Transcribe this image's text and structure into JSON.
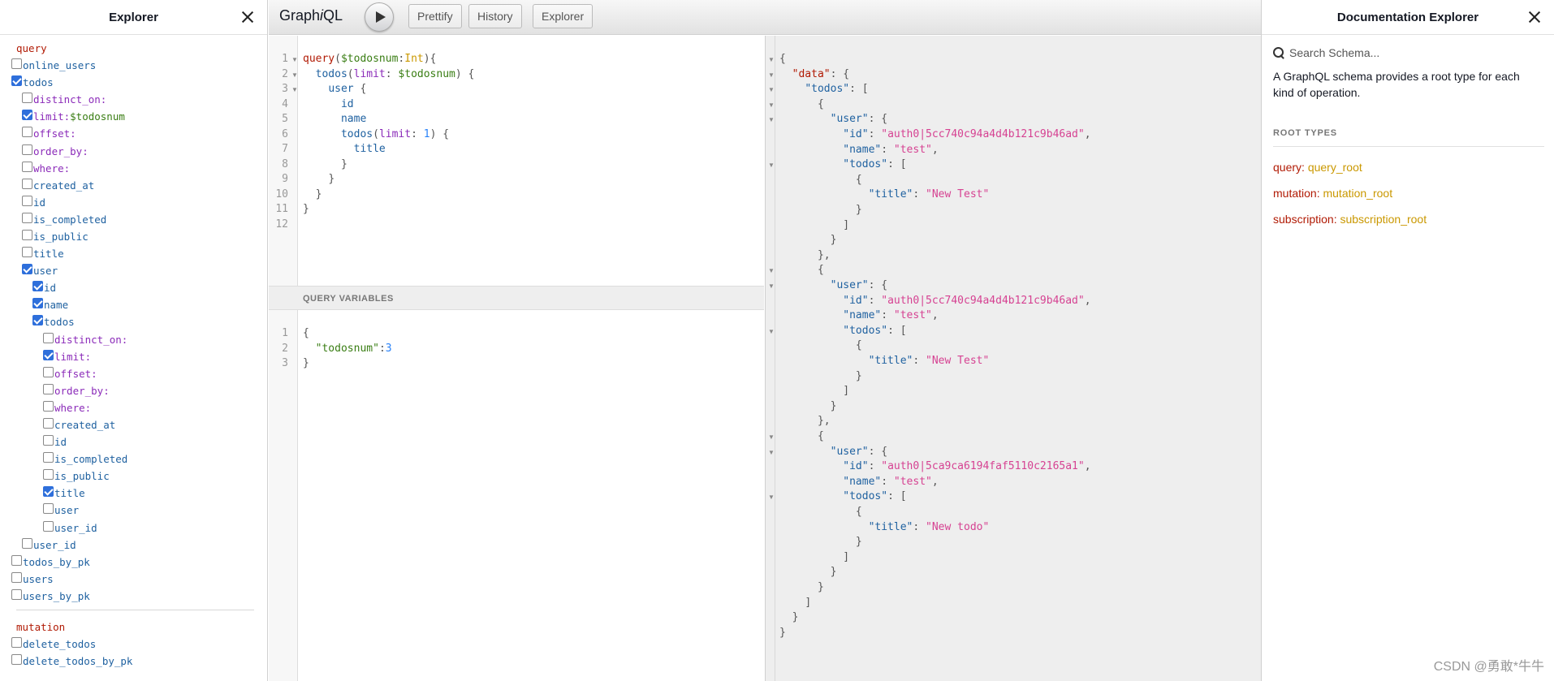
{
  "explorer": {
    "title": "Explorer",
    "query_label": "query",
    "mutation_label": "mutation",
    "rows": [
      {
        "indent": 0,
        "checked": false,
        "label": "online_users",
        "kind": "fld"
      },
      {
        "indent": 0,
        "checked": true,
        "label": "todos",
        "kind": "fld"
      },
      {
        "indent": 1,
        "checked": false,
        "label": "distinct_on:",
        "kind": "arg"
      },
      {
        "indent": 1,
        "checked": true,
        "label": "limit:",
        "kind": "arg",
        "value": "$todosnum"
      },
      {
        "indent": 1,
        "checked": false,
        "label": "offset:",
        "kind": "arg"
      },
      {
        "indent": 1,
        "checked": false,
        "label": "order_by:",
        "kind": "arg"
      },
      {
        "indent": 1,
        "checked": false,
        "label": "where:",
        "kind": "arg"
      },
      {
        "indent": 1,
        "checked": false,
        "label": "created_at",
        "kind": "fld"
      },
      {
        "indent": 1,
        "checked": false,
        "label": "id",
        "kind": "fld"
      },
      {
        "indent": 1,
        "checked": false,
        "label": "is_completed",
        "kind": "fld"
      },
      {
        "indent": 1,
        "checked": false,
        "label": "is_public",
        "kind": "fld"
      },
      {
        "indent": 1,
        "checked": false,
        "label": "title",
        "kind": "fld"
      },
      {
        "indent": 1,
        "checked": true,
        "label": "user",
        "kind": "fld"
      },
      {
        "indent": 2,
        "checked": true,
        "label": "id",
        "kind": "fld"
      },
      {
        "indent": 2,
        "checked": true,
        "label": "name",
        "kind": "fld"
      },
      {
        "indent": 2,
        "checked": true,
        "label": "todos",
        "kind": "fld"
      },
      {
        "indent": 3,
        "checked": false,
        "label": "distinct_on:",
        "kind": "arg"
      },
      {
        "indent": 3,
        "checked": true,
        "label": "limit:",
        "kind": "arg",
        "value": ""
      },
      {
        "indent": 3,
        "checked": false,
        "label": "offset:",
        "kind": "arg"
      },
      {
        "indent": 3,
        "checked": false,
        "label": "order_by:",
        "kind": "arg"
      },
      {
        "indent": 3,
        "checked": false,
        "label": "where:",
        "kind": "arg"
      },
      {
        "indent": 3,
        "checked": false,
        "label": "created_at",
        "kind": "fld"
      },
      {
        "indent": 3,
        "checked": false,
        "label": "id",
        "kind": "fld"
      },
      {
        "indent": 3,
        "checked": false,
        "label": "is_completed",
        "kind": "fld"
      },
      {
        "indent": 3,
        "checked": false,
        "label": "is_public",
        "kind": "fld"
      },
      {
        "indent": 3,
        "checked": true,
        "label": "title",
        "kind": "fld"
      },
      {
        "indent": 3,
        "checked": false,
        "label": "user",
        "kind": "fld"
      },
      {
        "indent": 3,
        "checked": false,
        "label": "user_id",
        "kind": "fld"
      },
      {
        "indent": 1,
        "checked": false,
        "label": "user_id",
        "kind": "fld"
      },
      {
        "indent": 0,
        "checked": false,
        "label": "todos_by_pk",
        "kind": "fld"
      },
      {
        "indent": 0,
        "checked": false,
        "label": "users",
        "kind": "fld"
      },
      {
        "indent": 0,
        "checked": false,
        "label": "users_by_pk",
        "kind": "fld"
      }
    ],
    "mutation_rows": [
      {
        "indent": 0,
        "checked": false,
        "label": "delete_todos",
        "kind": "fld"
      },
      {
        "indent": 0,
        "checked": false,
        "label": "delete_todos_by_pk",
        "kind": "fld"
      }
    ]
  },
  "toolbar": {
    "logo_prefix": "Graph",
    "logo_italic": "i",
    "logo_suffix": "QL",
    "prettify": "Prettify",
    "history": "History",
    "explorer": "Explorer"
  },
  "query_editor": {
    "line_numbers": [
      "1",
      "2",
      "3",
      "4",
      "5",
      "6",
      "7",
      "8",
      "9",
      "10",
      "11",
      "12"
    ],
    "fold_lines": [
      1,
      2,
      3
    ],
    "lines": [
      [
        {
          "t": "query",
          "c": "kw"
        },
        {
          "t": "(",
          "c": "punc"
        },
        {
          "t": "$todosnum",
          "c": "var"
        },
        {
          "t": ":",
          "c": "punc"
        },
        {
          "t": "Int",
          "c": "typ"
        },
        {
          "t": "){",
          "c": "punc"
        }
      ],
      [
        {
          "t": "  "
        },
        {
          "t": "todos",
          "c": "prop"
        },
        {
          "t": "(",
          "c": "punc"
        },
        {
          "t": "limit",
          "c": "arg"
        },
        {
          "t": ": ",
          "c": "punc"
        },
        {
          "t": "$todosnum",
          "c": "var"
        },
        {
          "t": ") {",
          "c": "punc"
        }
      ],
      [
        {
          "t": "    "
        },
        {
          "t": "user",
          "c": "prop"
        },
        {
          "t": " {",
          "c": "punc"
        }
      ],
      [
        {
          "t": "      "
        },
        {
          "t": "id",
          "c": "prop"
        }
      ],
      [
        {
          "t": "      "
        },
        {
          "t": "name",
          "c": "prop"
        }
      ],
      [
        {
          "t": "      "
        },
        {
          "t": "todos",
          "c": "prop"
        },
        {
          "t": "(",
          "c": "punc"
        },
        {
          "t": "limit",
          "c": "arg"
        },
        {
          "t": ": ",
          "c": "punc"
        },
        {
          "t": "1",
          "c": "num"
        },
        {
          "t": ") {",
          "c": "punc"
        }
      ],
      [
        {
          "t": "        "
        },
        {
          "t": "title",
          "c": "prop"
        }
      ],
      [
        {
          "t": "      "
        },
        {
          "t": "}",
          "c": "punc"
        }
      ],
      [
        {
          "t": "    "
        },
        {
          "t": "}",
          "c": "punc"
        }
      ],
      [
        {
          "t": "  "
        },
        {
          "t": "}",
          "c": "punc"
        }
      ],
      [
        {
          "t": "}",
          "c": "punc"
        }
      ],
      []
    ]
  },
  "vars": {
    "header": "QUERY VARIABLES",
    "line_numbers": [
      "1",
      "2",
      "3"
    ],
    "lines": [
      [
        {
          "t": "{",
          "c": "punc"
        }
      ],
      [
        {
          "t": "  "
        },
        {
          "t": "\"todosnum\"",
          "c": "var"
        },
        {
          "t": ":",
          "c": "punc"
        },
        {
          "t": "3",
          "c": "num"
        }
      ],
      [
        {
          "t": "}",
          "c": "punc"
        }
      ]
    ]
  },
  "result": {
    "fold_lines": [
      1,
      2,
      3,
      4,
      5,
      8,
      15,
      16,
      19,
      26,
      27,
      30
    ],
    "lines": [
      [
        {
          "t": "{",
          "c": "punc"
        }
      ],
      [
        {
          "t": "  "
        },
        {
          "t": "\"data\"",
          "c": "kw"
        },
        {
          "t": ": {",
          "c": "punc"
        }
      ],
      [
        {
          "t": "    "
        },
        {
          "t": "\"todos\"",
          "c": "jkey"
        },
        {
          "t": ": [",
          "c": "punc"
        }
      ],
      [
        {
          "t": "      "
        },
        {
          "t": "{",
          "c": "punc"
        }
      ],
      [
        {
          "t": "        "
        },
        {
          "t": "\"user\"",
          "c": "jkey"
        },
        {
          "t": ": {",
          "c": "punc"
        }
      ],
      [
        {
          "t": "          "
        },
        {
          "t": "\"id\"",
          "c": "jkey"
        },
        {
          "t": ": ",
          "c": "punc"
        },
        {
          "t": "\"auth0|5cc740c94a4d4b121c9b46ad\"",
          "c": "str"
        },
        {
          "t": ",",
          "c": "punc"
        }
      ],
      [
        {
          "t": "          "
        },
        {
          "t": "\"name\"",
          "c": "jkey"
        },
        {
          "t": ": ",
          "c": "punc"
        },
        {
          "t": "\"test\"",
          "c": "str"
        },
        {
          "t": ",",
          "c": "punc"
        }
      ],
      [
        {
          "t": "          "
        },
        {
          "t": "\"todos\"",
          "c": "jkey"
        },
        {
          "t": ": [",
          "c": "punc"
        }
      ],
      [
        {
          "t": "            "
        },
        {
          "t": "{",
          "c": "punc"
        }
      ],
      [
        {
          "t": "              "
        },
        {
          "t": "\"title\"",
          "c": "jkey"
        },
        {
          "t": ": ",
          "c": "punc"
        },
        {
          "t": "\"New Test\"",
          "c": "str"
        }
      ],
      [
        {
          "t": "            "
        },
        {
          "t": "}",
          "c": "punc"
        }
      ],
      [
        {
          "t": "          "
        },
        {
          "t": "]",
          "c": "punc"
        }
      ],
      [
        {
          "t": "        "
        },
        {
          "t": "}",
          "c": "punc"
        }
      ],
      [
        {
          "t": "      "
        },
        {
          "t": "},",
          "c": "punc"
        }
      ],
      [
        {
          "t": "      "
        },
        {
          "t": "{",
          "c": "punc"
        }
      ],
      [
        {
          "t": "        "
        },
        {
          "t": "\"user\"",
          "c": "jkey"
        },
        {
          "t": ": {",
          "c": "punc"
        }
      ],
      [
        {
          "t": "          "
        },
        {
          "t": "\"id\"",
          "c": "jkey"
        },
        {
          "t": ": ",
          "c": "punc"
        },
        {
          "t": "\"auth0|5cc740c94a4d4b121c9b46ad\"",
          "c": "str"
        },
        {
          "t": ",",
          "c": "punc"
        }
      ],
      [
        {
          "t": "          "
        },
        {
          "t": "\"name\"",
          "c": "jkey"
        },
        {
          "t": ": ",
          "c": "punc"
        },
        {
          "t": "\"test\"",
          "c": "str"
        },
        {
          "t": ",",
          "c": "punc"
        }
      ],
      [
        {
          "t": "          "
        },
        {
          "t": "\"todos\"",
          "c": "jkey"
        },
        {
          "t": ": [",
          "c": "punc"
        }
      ],
      [
        {
          "t": "            "
        },
        {
          "t": "{",
          "c": "punc"
        }
      ],
      [
        {
          "t": "              "
        },
        {
          "t": "\"title\"",
          "c": "jkey"
        },
        {
          "t": ": ",
          "c": "punc"
        },
        {
          "t": "\"New Test\"",
          "c": "str"
        }
      ],
      [
        {
          "t": "            "
        },
        {
          "t": "}",
          "c": "punc"
        }
      ],
      [
        {
          "t": "          "
        },
        {
          "t": "]",
          "c": "punc"
        }
      ],
      [
        {
          "t": "        "
        },
        {
          "t": "}",
          "c": "punc"
        }
      ],
      [
        {
          "t": "      "
        },
        {
          "t": "},",
          "c": "punc"
        }
      ],
      [
        {
          "t": "      "
        },
        {
          "t": "{",
          "c": "punc"
        }
      ],
      [
        {
          "t": "        "
        },
        {
          "t": "\"user\"",
          "c": "jkey"
        },
        {
          "t": ": {",
          "c": "punc"
        }
      ],
      [
        {
          "t": "          "
        },
        {
          "t": "\"id\"",
          "c": "jkey"
        },
        {
          "t": ": ",
          "c": "punc"
        },
        {
          "t": "\"auth0|5ca9ca6194faf5110c2165a1\"",
          "c": "str"
        },
        {
          "t": ",",
          "c": "punc"
        }
      ],
      [
        {
          "t": "          "
        },
        {
          "t": "\"name\"",
          "c": "jkey"
        },
        {
          "t": ": ",
          "c": "punc"
        },
        {
          "t": "\"test\"",
          "c": "str"
        },
        {
          "t": ",",
          "c": "punc"
        }
      ],
      [
        {
          "t": "          "
        },
        {
          "t": "\"todos\"",
          "c": "jkey"
        },
        {
          "t": ": [",
          "c": "punc"
        }
      ],
      [
        {
          "t": "            "
        },
        {
          "t": "{",
          "c": "punc"
        }
      ],
      [
        {
          "t": "              "
        },
        {
          "t": "\"title\"",
          "c": "jkey"
        },
        {
          "t": ": ",
          "c": "punc"
        },
        {
          "t": "\"New todo\"",
          "c": "str"
        }
      ],
      [
        {
          "t": "            "
        },
        {
          "t": "}",
          "c": "punc"
        }
      ],
      [
        {
          "t": "          "
        },
        {
          "t": "]",
          "c": "punc"
        }
      ],
      [
        {
          "t": "        "
        },
        {
          "t": "}",
          "c": "punc"
        }
      ],
      [
        {
          "t": "      "
        },
        {
          "t": "}",
          "c": "punc"
        }
      ],
      [
        {
          "t": "    "
        },
        {
          "t": "]",
          "c": "punc"
        }
      ],
      [
        {
          "t": "  "
        },
        {
          "t": "}",
          "c": "punc"
        }
      ],
      [
        {
          "t": "}",
          "c": "punc"
        }
      ]
    ]
  },
  "docs": {
    "title": "Documentation Explorer",
    "search_placeholder": "Search Schema...",
    "description": "A GraphQL schema provides a root type for each kind of operation.",
    "section": "ROOT TYPES",
    "root_types": [
      {
        "key": "query",
        "type": "query_root"
      },
      {
        "key": "mutation",
        "type": "mutation_root"
      },
      {
        "key": "subscription",
        "type": "subscription_root"
      }
    ]
  },
  "watermark": "CSDN @勇敢*牛牛"
}
